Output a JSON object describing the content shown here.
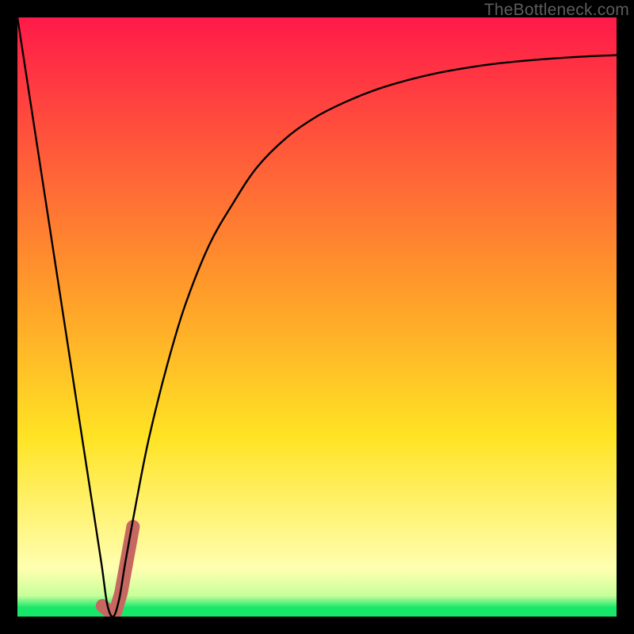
{
  "watermark": "TheBottleneck.com",
  "colors": {
    "top": "#ff1a49",
    "orange": "#ff8a2a",
    "yellow": "#ffe324",
    "pale": "#ffffb0",
    "green": "#17e86a",
    "curve": "#000000",
    "accent": "#c76761",
    "frame": "#000000"
  },
  "chart_data": {
    "type": "line",
    "title": "",
    "xlabel": "",
    "ylabel": "",
    "xlim": [
      0,
      100
    ],
    "ylim": [
      0,
      100
    ],
    "series": [
      {
        "name": "bottleneck-curve",
        "x": [
          0,
          2,
          4,
          6,
          8,
          10,
          12,
          14,
          15,
          16,
          17,
          18,
          20,
          22,
          25,
          28,
          32,
          36,
          40,
          45,
          50,
          55,
          60,
          65,
          70,
          75,
          80,
          85,
          90,
          95,
          100
        ],
        "y": [
          100,
          87,
          74,
          61,
          48,
          35,
          22,
          9,
          2,
          0,
          3,
          9,
          20,
          30,
          42,
          52,
          62,
          69,
          75,
          80,
          83.5,
          86,
          88,
          89.5,
          90.7,
          91.6,
          92.3,
          92.8,
          93.2,
          93.5,
          93.7
        ]
      },
      {
        "name": "highlighted-range",
        "x": [
          14.2,
          15.3,
          16.4,
          17.3,
          18.3,
          19.3
        ],
        "y": [
          1.8,
          0.9,
          0.9,
          4.0,
          9.5,
          15.0
        ]
      }
    ],
    "gradient_stops": [
      {
        "pos": 0.0,
        "color": "#ff1a49"
      },
      {
        "pos": 0.45,
        "color": "#ff9a2a"
      },
      {
        "pos": 0.7,
        "color": "#ffe324"
      },
      {
        "pos": 0.92,
        "color": "#ffffb0"
      },
      {
        "pos": 0.965,
        "color": "#c8ff9a"
      },
      {
        "pos": 0.985,
        "color": "#17e86a"
      },
      {
        "pos": 1.0,
        "color": "#17e86a"
      }
    ]
  }
}
